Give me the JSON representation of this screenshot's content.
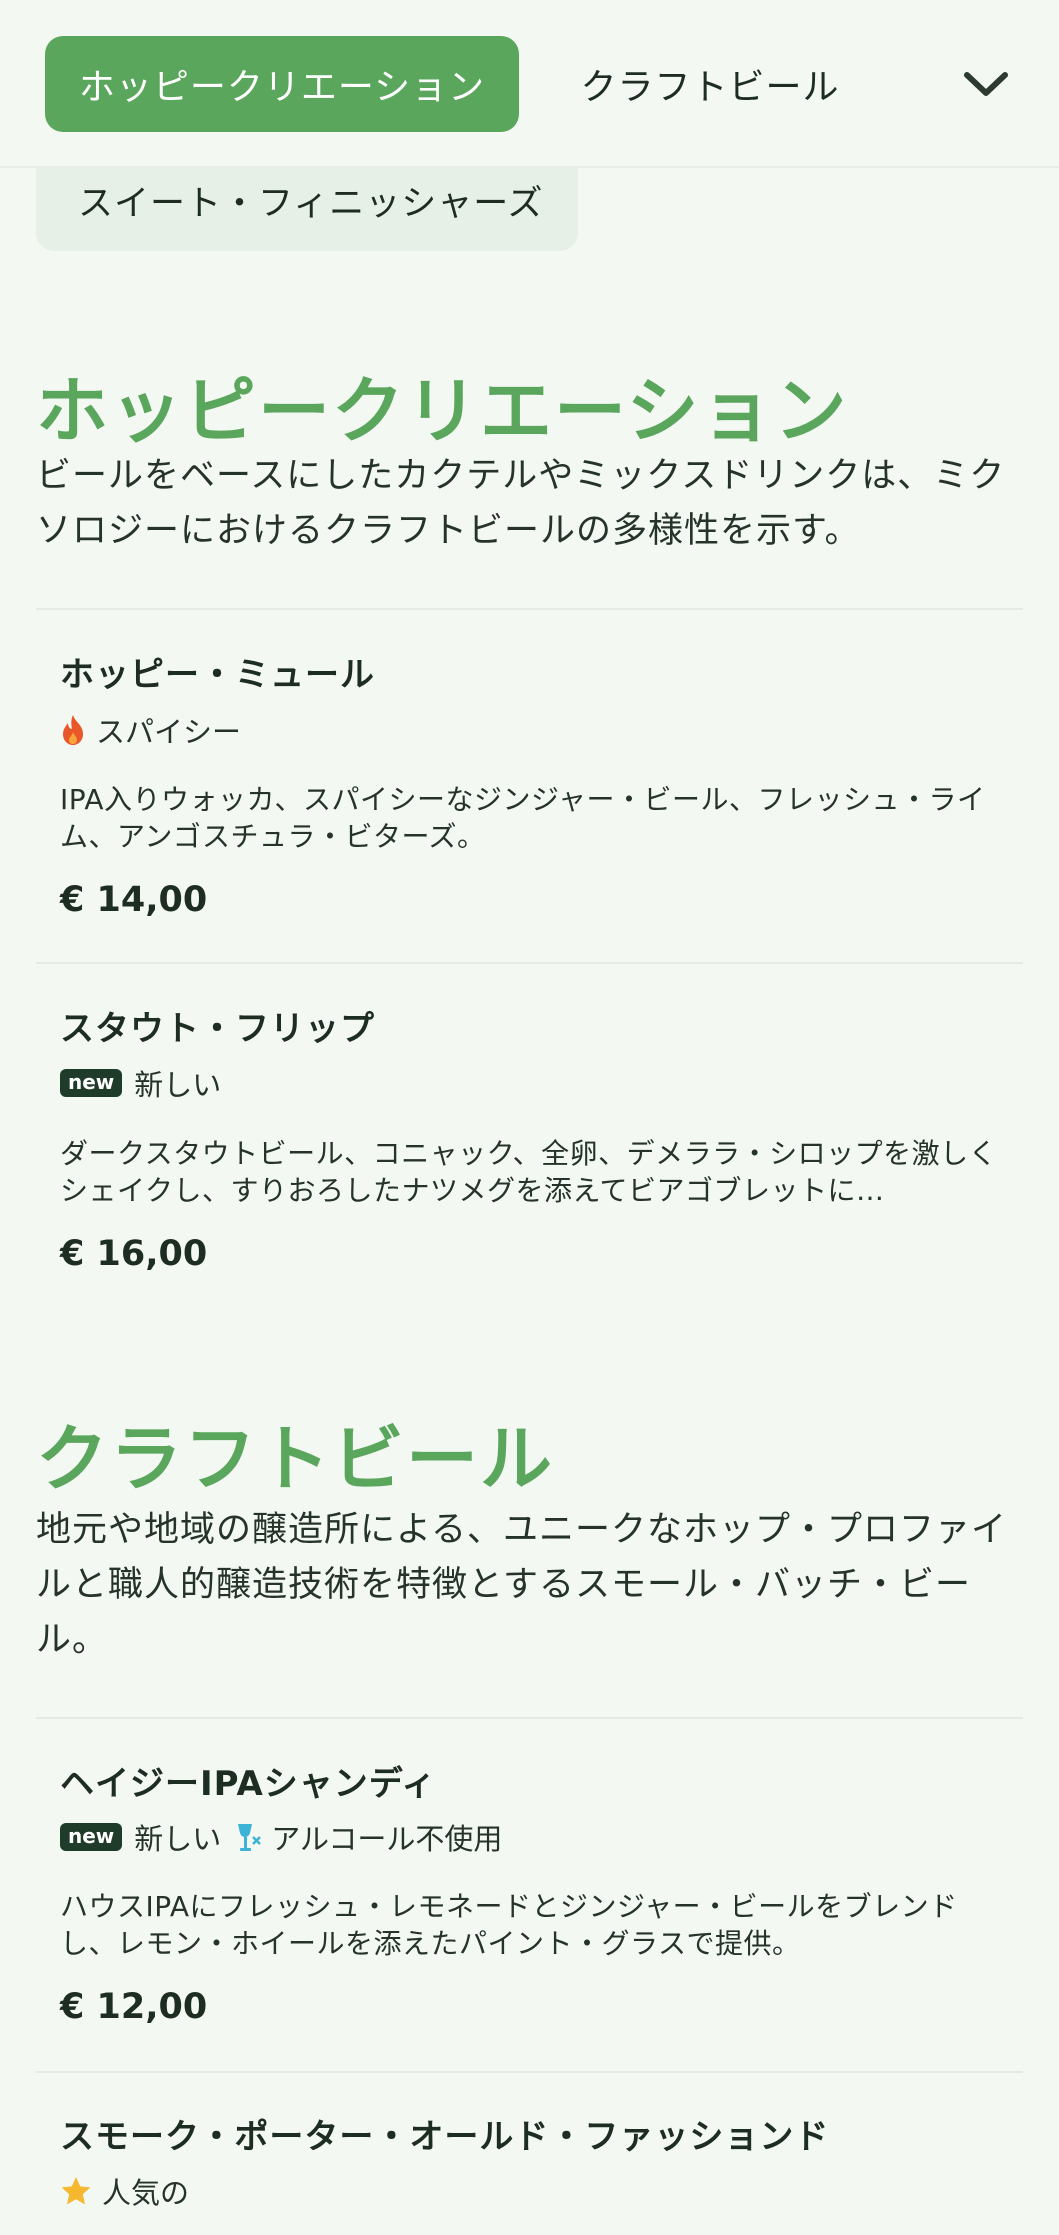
{
  "nav": {
    "active_tab": "ホッピークリエーション",
    "tab": "クラフトビール",
    "dropdown_item": "スイート・フィニッシャーズ"
  },
  "sections": [
    {
      "title": "ホッピークリエーション",
      "description": "ビールをベースにしたカクテルやミックスドリンクは、ミクソロジーにおけるクラフトビールの多様性を示す。",
      "items": [
        {
          "name": "ホッピー・ミュール",
          "tags": [
            {
              "icon": "fire-icon",
              "label": "スパイシー"
            }
          ],
          "description": "IPA入りウォッカ、スパイシーなジンジャー・ビール、フレッシュ・ライム、アンゴスチュラ・ビターズ。",
          "price": "€ 14,00"
        },
        {
          "name": "スタウト・フリップ",
          "tags": [
            {
              "badge": "new",
              "label": "新しい"
            }
          ],
          "description": "ダークスタウトビール、コニャック、全卵、デメララ・シロップを激しくシェイクし、すりおろしたナツメグを添えてビアゴブレットに…",
          "price": "€ 16,00"
        }
      ]
    },
    {
      "title": "クラフトビール",
      "description": "地元や地域の醸造所による、ユニークなホップ・プロファイルと職人的醸造技術を特徴とするスモール・バッチ・ビール。",
      "items": [
        {
          "name": "ヘイジーIPAシャンディ",
          "tags": [
            {
              "badge": "new",
              "label": "新しい"
            },
            {
              "icon": "alcohol-free-icon",
              "label": "アルコール不使用"
            }
          ],
          "description": "ハウスIPAにフレッシュ・レモネードとジンジャー・ビールをブレンドし、レモン・ホイールを添えたパイント・グラスで提供。",
          "price": "€ 12,00"
        },
        {
          "name": "スモーク・ポーター・オールド・ファッションド",
          "tags": [
            {
              "icon": "star-icon",
              "label": "人気の"
            }
          ]
        }
      ]
    }
  ],
  "colors": {
    "accent": "#5aa65c",
    "background": "#f3f8f2",
    "chip": "#e7f0e6",
    "badge": "#1f3b2a",
    "fire": "#e8562a",
    "star": "#f5b82e",
    "alcohol_free": "#3cb4d8"
  }
}
